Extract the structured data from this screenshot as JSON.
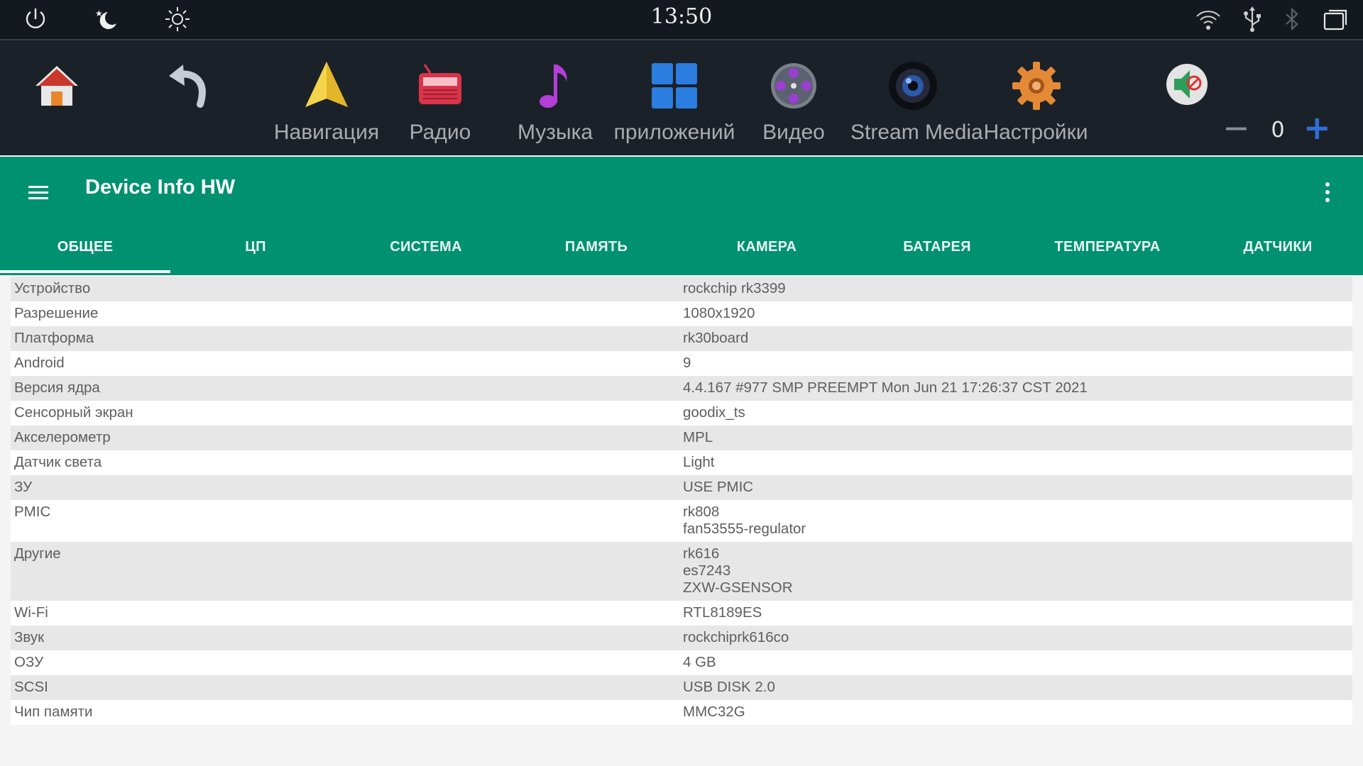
{
  "status_bar": {
    "time": "13:50",
    "icons": [
      "power-icon",
      "night-mode-icon",
      "brightness-icon",
      "wifi-icon",
      "usb-icon",
      "bluetooth-icon",
      "recent-apps-icon"
    ]
  },
  "dock": {
    "items": [
      {
        "id": "home",
        "icon": "home-icon",
        "label": ""
      },
      {
        "id": "back",
        "icon": "back-arrow-icon",
        "label": ""
      },
      {
        "id": "navigation",
        "icon": "navigation-icon",
        "label": "Навигация"
      },
      {
        "id": "radio",
        "icon": "radio-icon",
        "label": "Радио"
      },
      {
        "id": "music",
        "icon": "music-note-icon",
        "label": "Музыка"
      },
      {
        "id": "apps",
        "icon": "apps-grid-icon",
        "label": "приложений"
      },
      {
        "id": "video",
        "icon": "film-reel-icon",
        "label": "Видео"
      },
      {
        "id": "stream",
        "icon": "camera-lens-icon",
        "label": "Stream Media"
      },
      {
        "id": "settings",
        "icon": "gear-icon",
        "label": "Настройки"
      }
    ],
    "volume": {
      "minus": "−",
      "value": "0",
      "plus": "+",
      "icon": "speaker-mute-icon"
    }
  },
  "appbar": {
    "title": "Device Info HW",
    "accent": "#009170",
    "tabs": [
      "ОБЩЕЕ",
      "ЦП",
      "СИСТЕМА",
      "ПАМЯТЬ",
      "КАМЕРА",
      "БАТАРЕЯ",
      "ТЕМПЕРАТУРА",
      "ДАТЧИКИ"
    ],
    "active_tab": "ОБЩЕЕ"
  },
  "table": {
    "rows": [
      {
        "key": "Устройство",
        "value": [
          "rockchip rk3399"
        ]
      },
      {
        "key": "Разрешение",
        "value": [
          "1080x1920"
        ]
      },
      {
        "key": "Платформа",
        "value": [
          "rk30board"
        ]
      },
      {
        "key": "Android",
        "value": [
          "9"
        ]
      },
      {
        "key": "Версия ядра",
        "value": [
          "4.4.167 #977 SMP PREEMPT Mon Jun 21 17:26:37 CST 2021"
        ]
      },
      {
        "key": "Сенсорный экран",
        "value": [
          "goodix_ts"
        ]
      },
      {
        "key": "Акселерометр",
        "value": [
          "MPL"
        ]
      },
      {
        "key": "Датчик света",
        "value": [
          "Light"
        ]
      },
      {
        "key": "ЗУ",
        "value": [
          "USE PMIC"
        ]
      },
      {
        "key": "PMIC",
        "value": [
          "rk808",
          "fan53555-regulator"
        ]
      },
      {
        "key": "Другие",
        "value": [
          "rk616",
          "es7243",
          "ZXW-GSENSOR"
        ]
      },
      {
        "key": "Wi-Fi",
        "value": [
          "RTL8189ES"
        ]
      },
      {
        "key": "Звук",
        "value": [
          "rockchiprk616co"
        ]
      },
      {
        "key": "ОЗУ",
        "value": [
          "4 GB"
        ]
      },
      {
        "key": "SCSI",
        "value": [
          "USB DISK 2.0"
        ]
      },
      {
        "key": "Чип памяти",
        "value": [
          "MMC32G"
        ]
      }
    ]
  }
}
